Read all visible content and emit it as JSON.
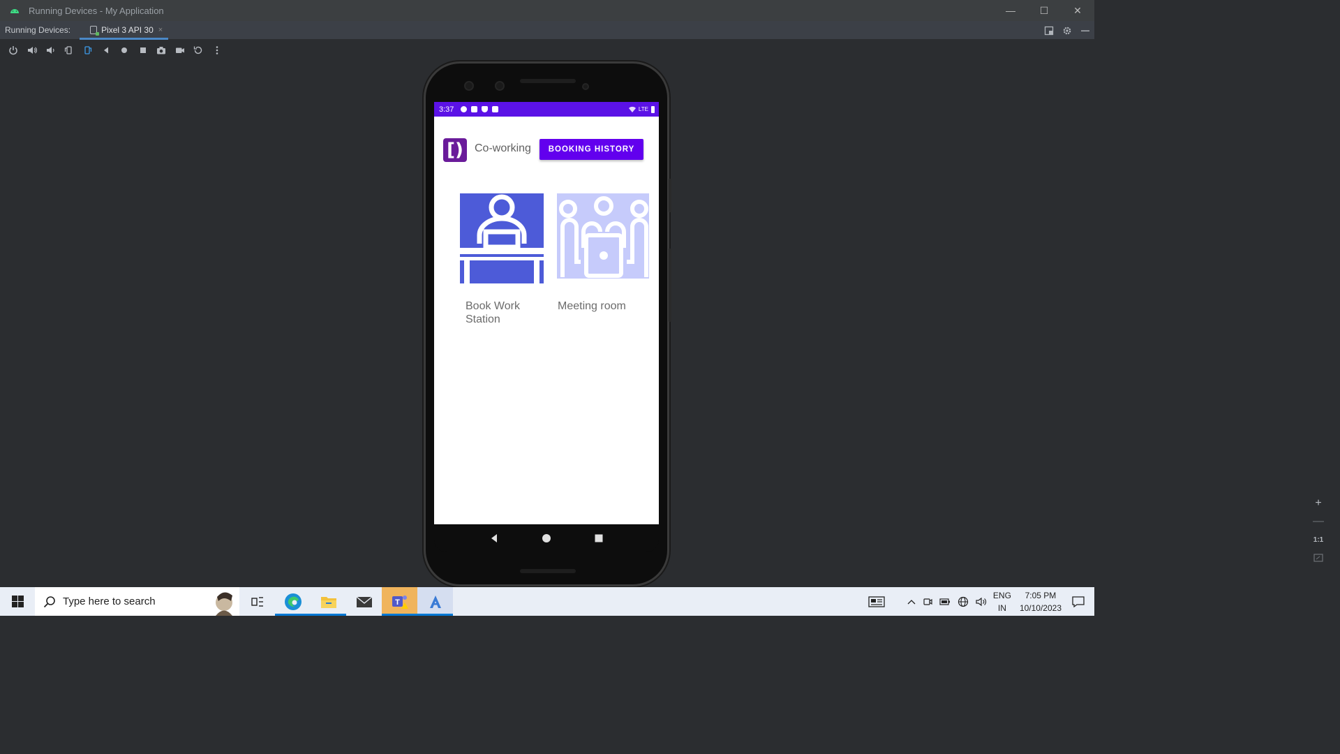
{
  "window": {
    "title": "Running Devices - My Application",
    "controls": {
      "minimize": "—",
      "maximize": "☐",
      "close": "✕"
    }
  },
  "tabbar": {
    "label": "Running Devices:",
    "tab_label": "Pixel 3 API 30",
    "tab_close": "×"
  },
  "phone": {
    "status": {
      "time": "3:37",
      "network": "LTE"
    },
    "app": {
      "logo": "[)",
      "title": "Co-working",
      "booking_button": "BOOKING HISTORY",
      "cards": [
        {
          "label": "Book Work Station"
        },
        {
          "label": "Meeting room"
        }
      ]
    }
  },
  "zoom": {
    "in": "+",
    "out": "—",
    "actual": "1:1"
  },
  "taskbar": {
    "search_placeholder": "Type here to search",
    "lang_top": "ENG",
    "lang_bottom": "IN",
    "time": "7:05 PM",
    "date": "10/10/2023"
  },
  "colors": {
    "status_bar": "#5b12e6",
    "button": "#6200ee",
    "logo": "#6a1b9a",
    "workstation_img": "#4d5bd8",
    "meeting_img": "#c6cbfb"
  }
}
